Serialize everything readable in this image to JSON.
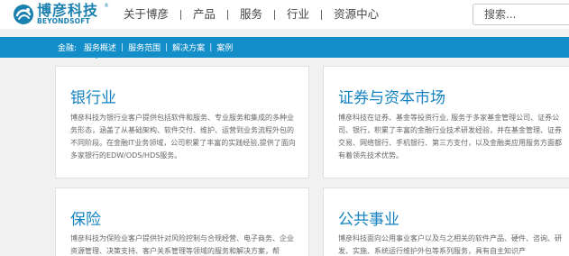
{
  "header": {
    "logo": {
      "cn": "博彦科技",
      "en": "BEYONDSOFT",
      "reg": "®"
    },
    "nav": [
      "关于博彦",
      "产品",
      "服务",
      "行业",
      "资源中心"
    ],
    "search_placeholder": "搜索..."
  },
  "subnav": {
    "prefix": "金融:",
    "items": [
      "服务概述",
      "服务范围",
      "解决方案",
      "案例"
    ],
    "separator": "|"
  },
  "cards": [
    {
      "title": "银行业",
      "body": "博彦科技为银行业客户提供包括软件和服务、专业服务和集成的多种业务形态，涵盖了从基础架构、软件交付、维护、运营到业务流程外包的不同阶段。在金融IT业务领域，公司积累了丰富的实践经验,提供了面向多家银行的EDW/ODS/HDS服务。"
    },
    {
      "title": "证券与资本市场",
      "body": "博彦科技在证券、基金等投资行业, 服务于多家基金管理公司、证券公司、银行，积累了丰富的金融行业技术研发经验，并在基金管理、证券交易、网络银行、手机银行、第三方支付，以及金融类应用服务方面都有着领先技术优势。"
    },
    {
      "title": "保险",
      "body": "博彦科技为保险业客户提供针对风险控制与合规经营、电子商务、企业资源管理、决策支持、客户关系管理等领域的服务和解决方案，帮"
    },
    {
      "title": "公共事业",
      "body": "博彦科技面向公用事业客户以及与之相关的软件产品、硬件、咨询、研发、实施、系统运行维护外包等系列服务，具有自主知识产"
    }
  ],
  "colors": {
    "brand": "#1583c2",
    "bar": "#148ec9",
    "page_bg": "#f1f1f1"
  }
}
